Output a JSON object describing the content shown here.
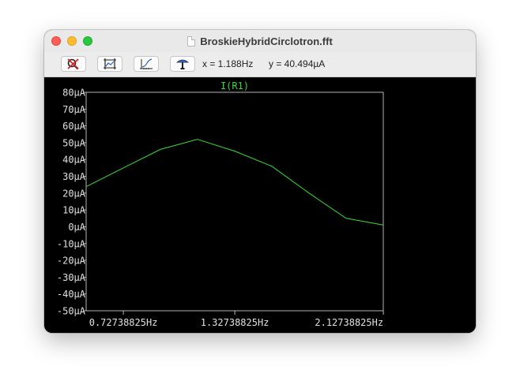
{
  "window": {
    "title": "BroskieHybridCirclotron.fft"
  },
  "toolbar": {
    "buttons": [
      {
        "name": "zoom-cancel-icon"
      },
      {
        "name": "autorange-icon"
      },
      {
        "name": "log-scale-icon"
      },
      {
        "name": "probe-icon"
      }
    ],
    "cursor_x": "x = 1.188Hz",
    "cursor_y": "y = 40.494µA"
  },
  "colors": {
    "trace": "#33dd33",
    "axis": "#e0e0e0",
    "background": "#000000"
  },
  "chart_data": {
    "type": "line",
    "title": "I(R1)",
    "xlabel": "",
    "ylabel": "",
    "x_ticks": [
      "0.72738825Hz",
      "1.32738825Hz",
      "2.12738825Hz"
    ],
    "y_ticks": [
      "80µA",
      "70µA",
      "60µA",
      "50µA",
      "40µA",
      "30µA",
      "20µA",
      "10µA",
      "0µA",
      "-10µA",
      "-20µA",
      "-30µA",
      "-40µA",
      "-50µA"
    ],
    "ylim": [
      -50,
      80
    ],
    "grid": false,
    "series": [
      {
        "name": "I(R1)",
        "x": [
          0.527,
          0.727,
          0.927,
          1.127,
          1.327,
          1.527,
          1.727,
          1.927,
          2.127
        ],
        "values": [
          23.8,
          35,
          46,
          52,
          45,
          36,
          20,
          5,
          1
        ]
      }
    ]
  }
}
